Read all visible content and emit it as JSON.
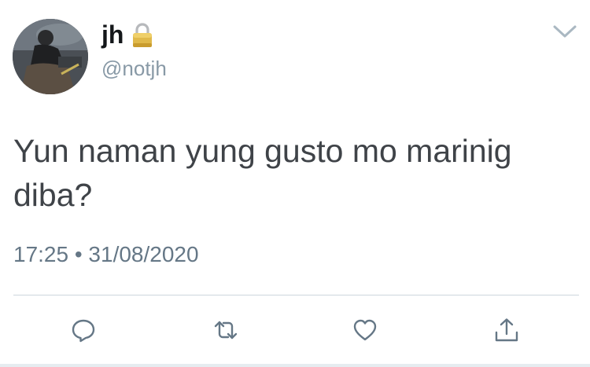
{
  "user": {
    "display_name": "jh",
    "handle": "@notjh",
    "protected_icon": "lock-icon",
    "avatar": "avatar"
  },
  "menu": {
    "icon": "chevron-down-icon"
  },
  "tweet": {
    "text": "Yun naman yung gusto mo marinig diba?",
    "timestamp": "17:25 • 31/08/2020"
  },
  "actions": [
    {
      "icon": "reply-icon"
    },
    {
      "icon": "retweet-icon"
    },
    {
      "icon": "like-icon"
    },
    {
      "icon": "share-icon"
    }
  ],
  "colors": {
    "text": "#14171a",
    "secondary": "#8899a6",
    "icon": "#657786",
    "divider": "#ccd6dd"
  }
}
